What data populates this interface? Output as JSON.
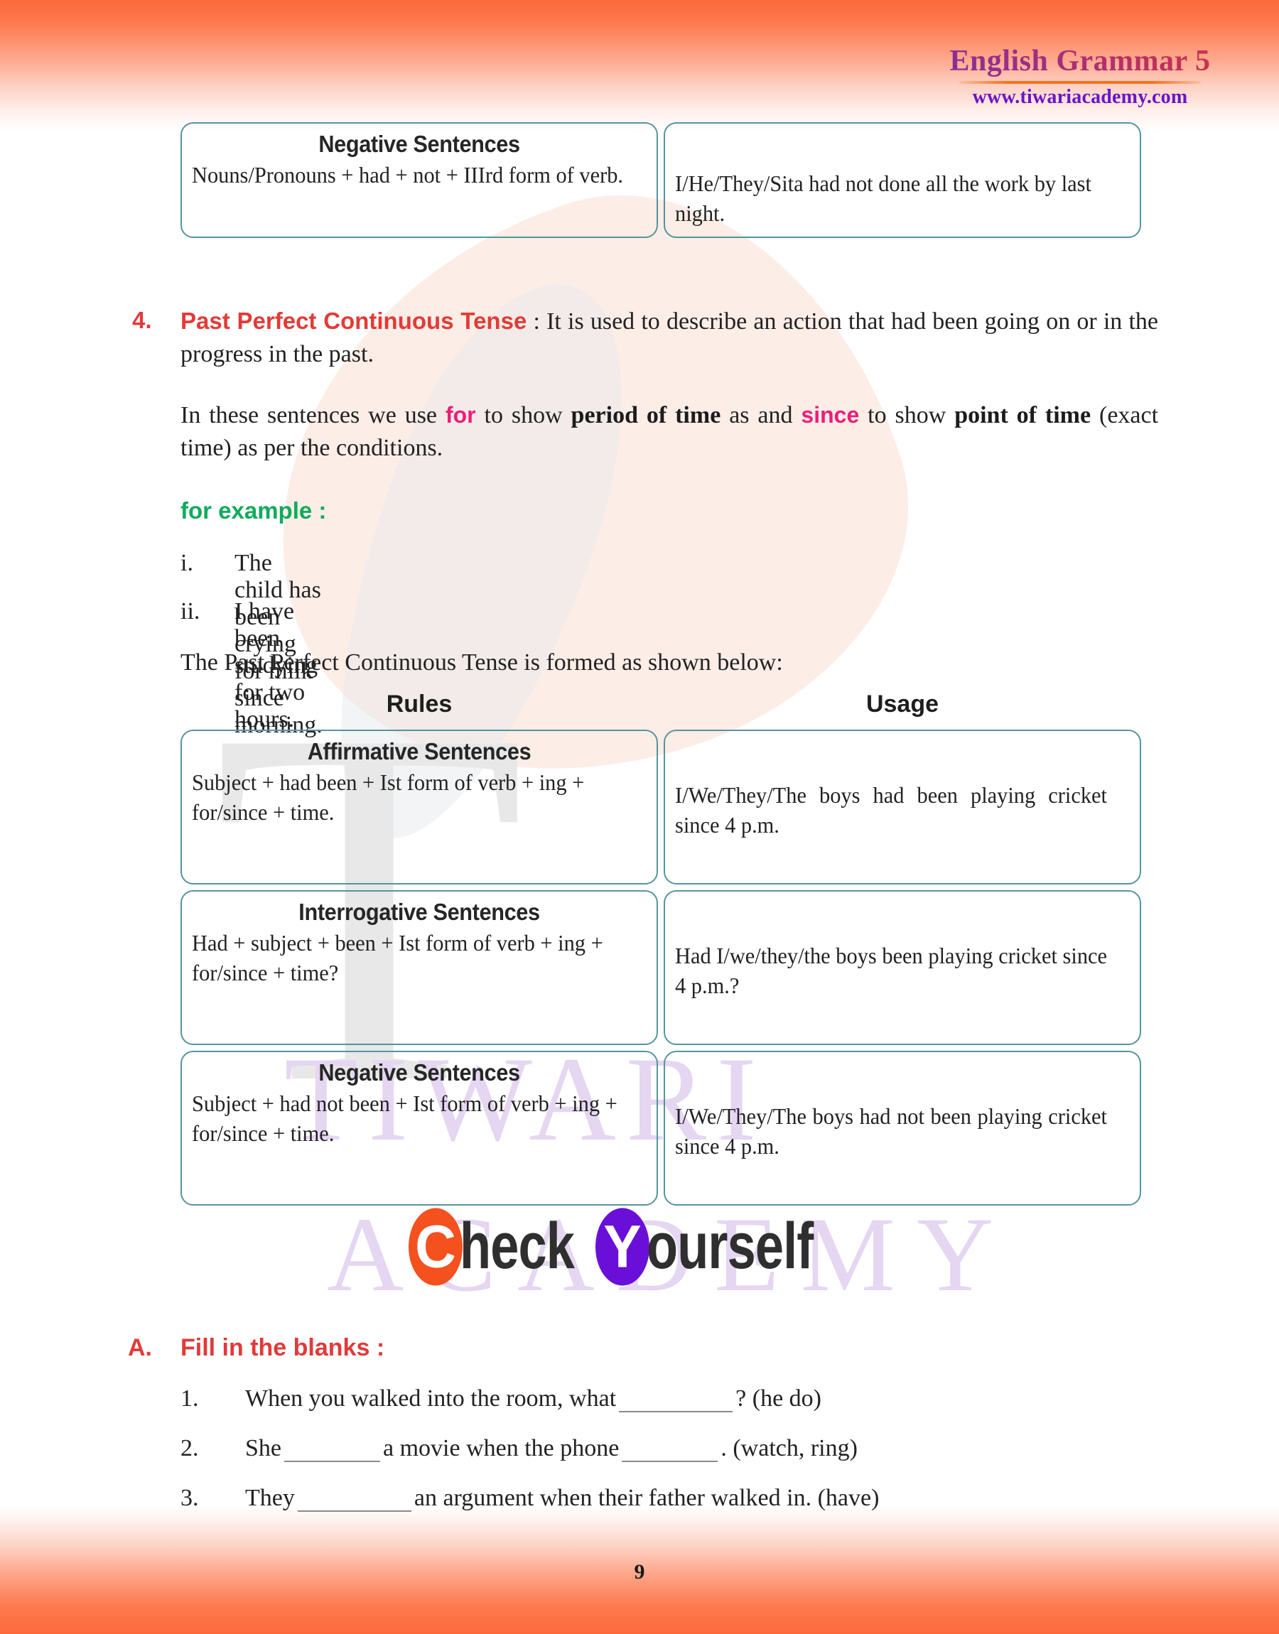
{
  "header": {
    "title": "English Grammar 5",
    "url": "www.tiwariacademy.com"
  },
  "watermark": {
    "big_letter": "T",
    "line1": "TIWARI",
    "line2": "ACADEMY"
  },
  "top_table": {
    "rows": [
      {
        "rule_heading": "Negative Sentences",
        "rule_body": "Nouns/Pronouns + had + not + IIIrd form of verb.",
        "usage": "I/He/They/Sita had not done all the work by last night."
      }
    ]
  },
  "section": {
    "number": "4.",
    "title": "Past Perfect Continuous Tense",
    "title_sep": " : ",
    "definition": "It is used to describe an action that had been going on or in the progress in the past.",
    "usage_note": {
      "part1": "In these sentences we use ",
      "for": "for",
      "part2": " to show ",
      "period": "period of time",
      "part3": " as and ",
      "since": "since",
      "part4": " to show ",
      "point": "point of time",
      "part5": " (exact time) as per the conditions."
    },
    "example_label": "for example :",
    "examples": [
      {
        "marker": "i.",
        "text": "The child has been crying for milk since morning."
      },
      {
        "marker": "ii.",
        "text": "I have been studying for two hours."
      }
    ],
    "formed_note": "The Past Perfect Continuous Tense is formed as shown below:"
  },
  "main_table": {
    "col_headers": [
      "Rules",
      "Usage"
    ],
    "rows": [
      {
        "rule_heading": "Affirmative Sentences",
        "rule_body": "Subject + had been + Ist form of verb + ing + for/since + time.",
        "usage": "I/We/They/The boys had been playing cricket since 4 p.m."
      },
      {
        "rule_heading": "Interrogative Sentences",
        "rule_body": "Had + subject + been + Ist form of verb + ing + for/since + time?",
        "usage": "Had I/we/they/the boys been playing cricket since 4 p.m.?"
      },
      {
        "rule_heading": "Negative Sentences",
        "rule_body": "Subject + had not been + Ist form of verb + ing + for/since + time.",
        "usage": "I/We/They/The boys had not been playing cricket since 4 p.m."
      }
    ]
  },
  "check_yourself": {
    "c_letter": "C",
    "word1": "heck",
    "y_letter": "Y",
    "word2": "ourself"
  },
  "exercise": {
    "letter": "A.",
    "title": "Fill in the blanks :",
    "questions": [
      {
        "num": "1.",
        "before": "When you walked into the room, what",
        "after": "? (he do)",
        "mid": "",
        "tail": ""
      },
      {
        "num": "2.",
        "before": "She",
        "mid": "a movie when the phone",
        "after": ". (watch, ring)",
        "tail": ""
      },
      {
        "num": "3.",
        "before": "They",
        "mid": "",
        "after": "an argument when their father walked in. (have)",
        "tail": ""
      }
    ]
  },
  "footer": {
    "page_number": "9"
  },
  "colors": {
    "accent_red": "#e23b36",
    "accent_pink": "#ec1e79",
    "accent_green": "#10ab5c",
    "border_teal": "#55959c",
    "band_orange": "#fc6a3c",
    "url_purple": "#6a14c9"
  }
}
